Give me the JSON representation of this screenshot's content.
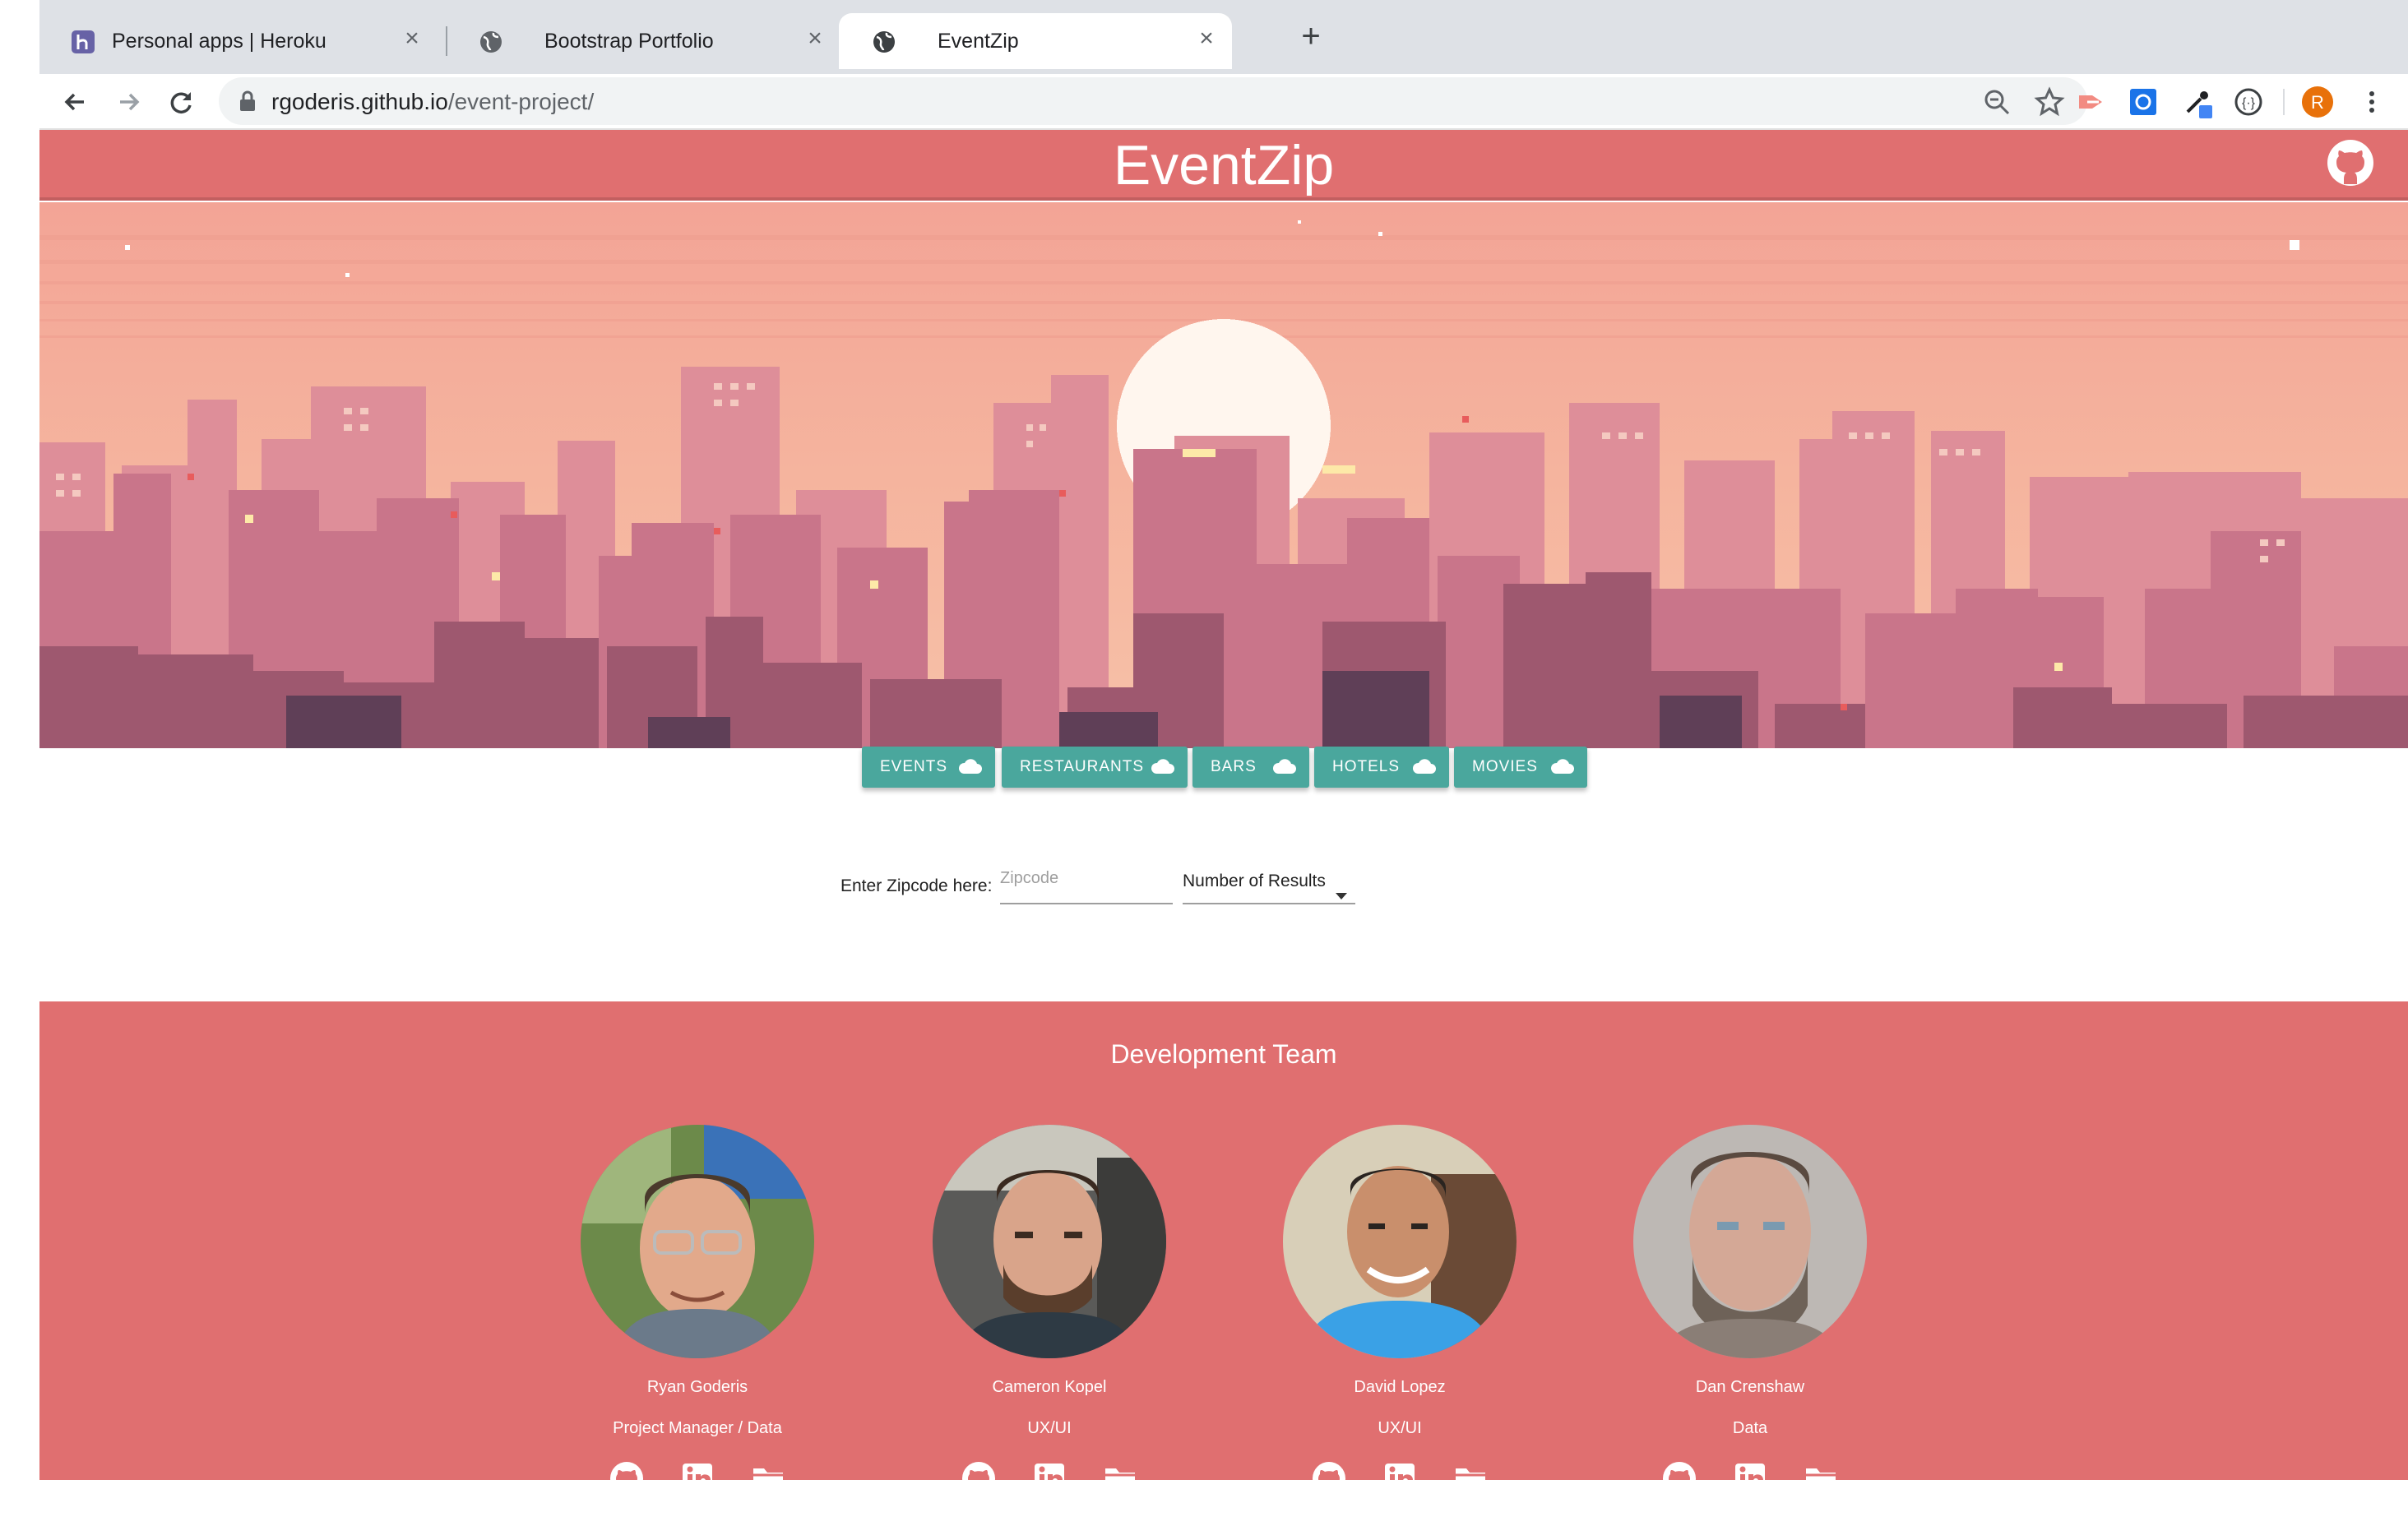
{
  "browser": {
    "tabs": [
      {
        "title": "Personal apps | Heroku",
        "icon": "heroku-icon",
        "active": false
      },
      {
        "title": "Bootstrap Portfolio",
        "icon": "globe-icon",
        "active": false
      },
      {
        "title": "EventZip",
        "icon": "globe-icon",
        "active": true
      }
    ],
    "url_host": "rgoderis.github.io",
    "url_path": "/event-project/",
    "profile_initial": "R",
    "colors": {
      "profile": "#e8710a",
      "tabstrip": "#dee1e6"
    }
  },
  "site": {
    "title": "EventZip",
    "header_color": "#e06f70"
  },
  "categories": [
    {
      "label": "EVENTS",
      "icon": "cloud-icon"
    },
    {
      "label": "RESTAURANTS",
      "icon": "cloud-icon"
    },
    {
      "label": "BARS",
      "icon": "cloud-icon"
    },
    {
      "label": "HOTELS",
      "icon": "cloud-icon"
    },
    {
      "label": "MOVIES",
      "icon": "cloud-icon"
    }
  ],
  "search": {
    "label": "Enter Zipcode here:",
    "zip_placeholder": "Zipcode",
    "zip_value": "",
    "results_label": "Number of Results"
  },
  "team": {
    "title": "Development Team",
    "members": [
      {
        "name": "Ryan Goderis",
        "role": "Project Manager / Data"
      },
      {
        "name": "Cameron Kopel",
        "role": "UX/UI"
      },
      {
        "name": "David Lopez",
        "role": "UX/UI"
      },
      {
        "name": "Dan Crenshaw",
        "role": "Data"
      }
    ],
    "link_icons": [
      "github-icon",
      "linkedin-icon",
      "folder-icon"
    ]
  },
  "theme": {
    "accent": "#4aa79d",
    "coral": "#e06f70"
  }
}
